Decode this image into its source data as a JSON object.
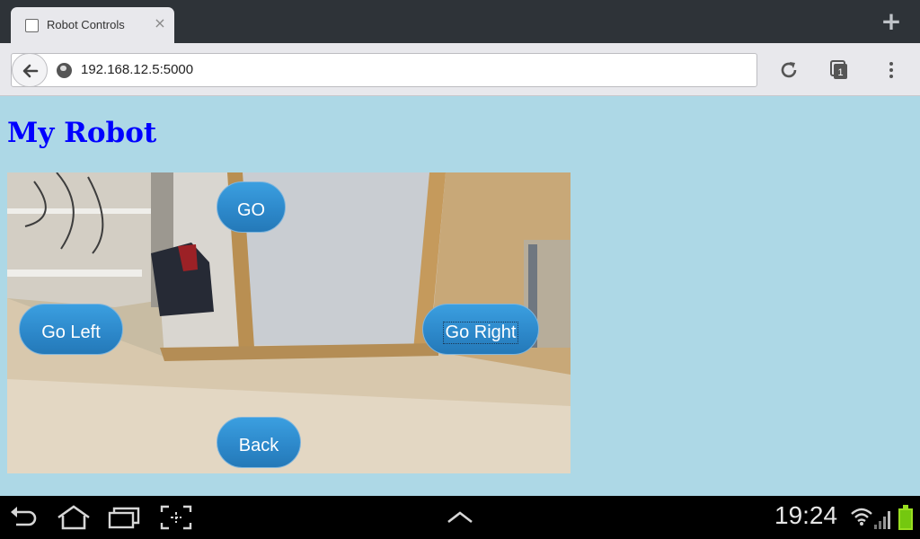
{
  "browser": {
    "tab_title": "Robot Controls",
    "tab_close": "×",
    "new_tab": "+",
    "url": "192.168.12.5:5000",
    "tab_count": "1"
  },
  "page": {
    "heading": "My Robot",
    "controls": {
      "go": "GO",
      "go_left": "Go Left",
      "go_right": "Go Right",
      "back": "Back"
    }
  },
  "system_bar": {
    "time": "19:24"
  },
  "colors": {
    "heading": "#0000ff",
    "page_background": "#add8e6",
    "button": "#2c87c9"
  }
}
